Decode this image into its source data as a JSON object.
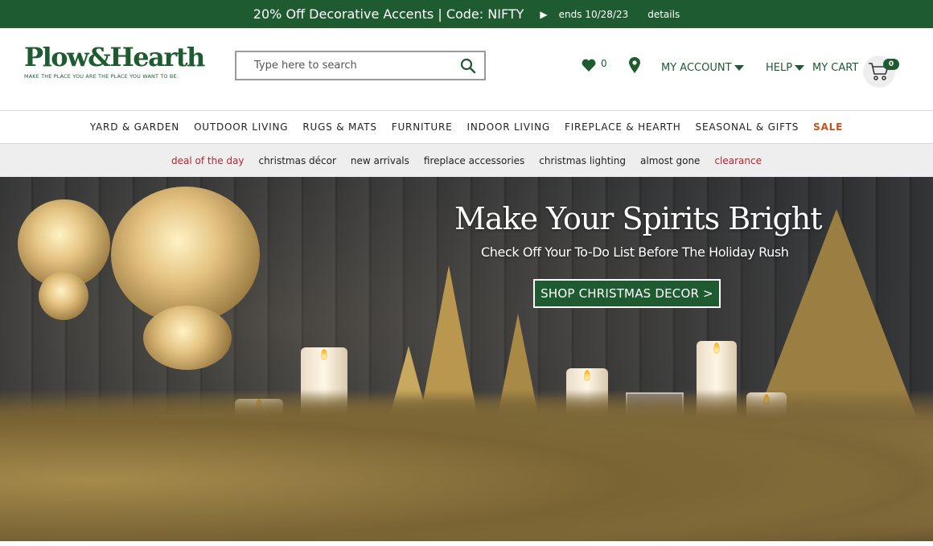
{
  "promo": {
    "message": "20% Off Decorative Accents | Code: NIFTY",
    "arrow": "▶",
    "ends": "ends 10/28/23",
    "details": "details"
  },
  "header": {
    "logo_name": "Plow&Hearth",
    "logo_tagline": "MAKE THE PLACE YOU ARE THE PLACE YOU WANT TO BE.",
    "search_placeholder": "Type here to search",
    "wishlist_count": "0",
    "my_account": "MY ACCOUNT",
    "help": "HELP",
    "my_cart": "MY CART",
    "cart_count": "0"
  },
  "nav": {
    "items": [
      "YARD & GARDEN",
      "OUTDOOR LIVING",
      "RUGS & MATS",
      "FURNITURE",
      "INDOOR LIVING",
      "FIREPLACE & HEARTH",
      "SEASONAL & GIFTS",
      "SALE"
    ]
  },
  "subnav": {
    "items": [
      "deal of the day",
      "christmas décor",
      "new arrivals",
      "fireplace accessories",
      "christmas lighting",
      "almost gone",
      "clearance"
    ]
  },
  "hero": {
    "title": "Make Your Spirits Bright",
    "subtitle": "Check Off Your To-Do List Before The Holiday Rush",
    "cta": "SHOP CHRISTMAS DECOR >"
  },
  "colors": {
    "brand_green": "#1f5b31",
    "sale_orange": "#c7501e",
    "accent_red": "#b6252f"
  }
}
